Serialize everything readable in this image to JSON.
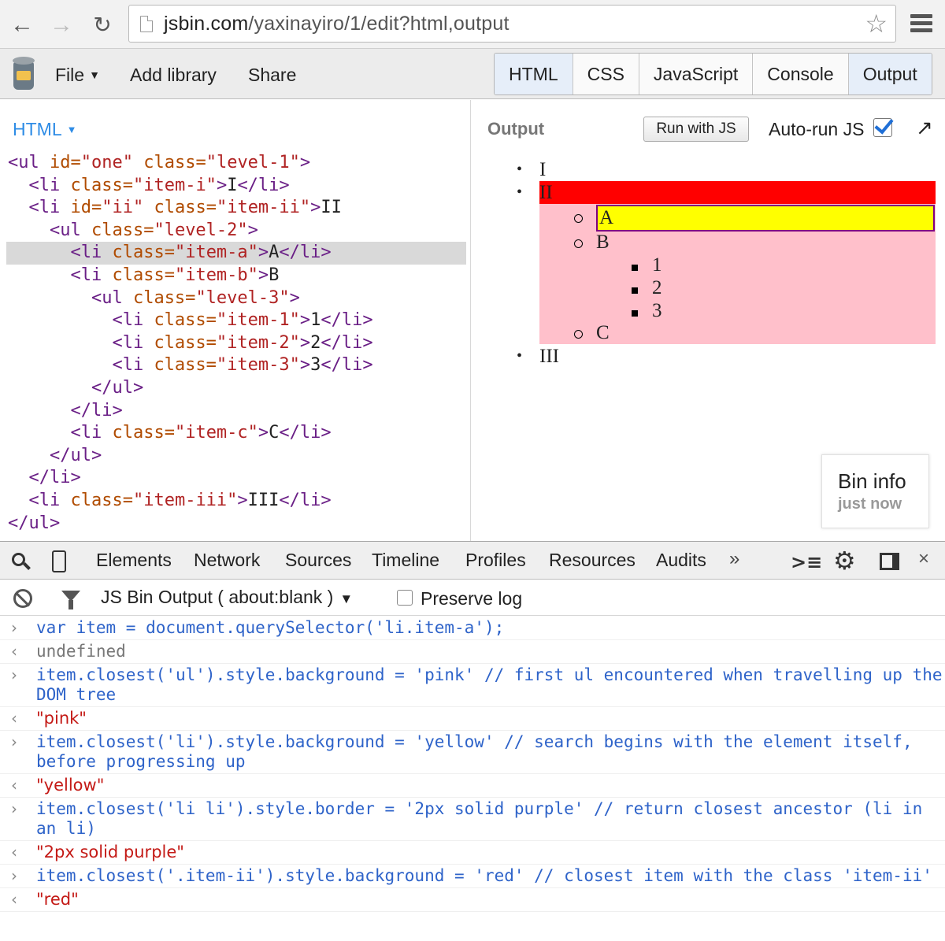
{
  "browser": {
    "back_icon": "back-arrow-icon",
    "forward_icon": "forward-arrow-icon",
    "reload_icon": "reload-icon",
    "url_host": "jsbin.com",
    "url_path": "/yaxinayiro/1/edit?html,output"
  },
  "jsbin": {
    "menu": {
      "file": "File",
      "add_library": "Add library",
      "share": "Share"
    },
    "panel_tabs": [
      "HTML",
      "CSS",
      "JavaScript",
      "Console",
      "Output"
    ]
  },
  "html_pane": {
    "label": "HTML",
    "code_lines": [
      {
        "indent": "",
        "parts": [
          [
            "t",
            "<ul "
          ],
          [
            "a",
            "id="
          ],
          [
            "s",
            "\"one\" "
          ],
          [
            "a",
            "class="
          ],
          [
            "s",
            "\"level-1\""
          ],
          [
            "t",
            ">"
          ]
        ]
      },
      {
        "indent": "  ",
        "parts": [
          [
            "t",
            "<li "
          ],
          [
            "a",
            "class="
          ],
          [
            "s",
            "\"item-i\""
          ],
          [
            "t",
            ">"
          ],
          [
            "x",
            "I"
          ],
          [
            "t",
            "</li>"
          ]
        ]
      },
      {
        "indent": "  ",
        "parts": [
          [
            "t",
            "<li "
          ],
          [
            "a",
            "id="
          ],
          [
            "s",
            "\"ii\" "
          ],
          [
            "a",
            "class="
          ],
          [
            "s",
            "\"item-ii\""
          ],
          [
            "t",
            ">"
          ],
          [
            "x",
            "II"
          ]
        ]
      },
      {
        "indent": "    ",
        "parts": [
          [
            "t",
            "<ul "
          ],
          [
            "a",
            "class="
          ],
          [
            "s",
            "\"level-2\""
          ],
          [
            "t",
            ">"
          ]
        ]
      },
      {
        "indent": "      ",
        "parts": [
          [
            "t",
            "<li "
          ],
          [
            "a",
            "class="
          ],
          [
            "s",
            "\"item-a\""
          ],
          [
            "t",
            ">"
          ],
          [
            "x",
            "A"
          ],
          [
            "t",
            "</li>"
          ]
        ],
        "highlight": true
      },
      {
        "indent": "      ",
        "parts": [
          [
            "t",
            "<li "
          ],
          [
            "a",
            "class="
          ],
          [
            "s",
            "\"item-b\""
          ],
          [
            "t",
            ">"
          ],
          [
            "x",
            "B"
          ]
        ]
      },
      {
        "indent": "        ",
        "parts": [
          [
            "t",
            "<ul "
          ],
          [
            "a",
            "class="
          ],
          [
            "s",
            "\"level-3\""
          ],
          [
            "t",
            ">"
          ]
        ]
      },
      {
        "indent": "          ",
        "parts": [
          [
            "t",
            "<li "
          ],
          [
            "a",
            "class="
          ],
          [
            "s",
            "\"item-1\""
          ],
          [
            "t",
            ">"
          ],
          [
            "x",
            "1"
          ],
          [
            "t",
            "</li>"
          ]
        ]
      },
      {
        "indent": "          ",
        "parts": [
          [
            "t",
            "<li "
          ],
          [
            "a",
            "class="
          ],
          [
            "s",
            "\"item-2\""
          ],
          [
            "t",
            ">"
          ],
          [
            "x",
            "2"
          ],
          [
            "t",
            "</li>"
          ]
        ]
      },
      {
        "indent": "          ",
        "parts": [
          [
            "t",
            "<li "
          ],
          [
            "a",
            "class="
          ],
          [
            "s",
            "\"item-3\""
          ],
          [
            "t",
            ">"
          ],
          [
            "x",
            "3"
          ],
          [
            "t",
            "</li>"
          ]
        ]
      },
      {
        "indent": "        ",
        "parts": [
          [
            "t",
            "</ul>"
          ]
        ]
      },
      {
        "indent": "      ",
        "parts": [
          [
            "t",
            "</li>"
          ]
        ]
      },
      {
        "indent": "      ",
        "parts": [
          [
            "t",
            "<li "
          ],
          [
            "a",
            "class="
          ],
          [
            "s",
            "\"item-c\""
          ],
          [
            "t",
            ">"
          ],
          [
            "x",
            "C"
          ],
          [
            "t",
            "</li>"
          ]
        ]
      },
      {
        "indent": "    ",
        "parts": [
          [
            "t",
            "</ul>"
          ]
        ]
      },
      {
        "indent": "  ",
        "parts": [
          [
            "t",
            "</li>"
          ]
        ]
      },
      {
        "indent": "  ",
        "parts": [
          [
            "t",
            "<li "
          ],
          [
            "a",
            "class="
          ],
          [
            "s",
            "\"item-iii\""
          ],
          [
            "t",
            ">"
          ],
          [
            "x",
            "III"
          ],
          [
            "t",
            "</li>"
          ]
        ]
      },
      {
        "indent": "",
        "parts": [
          [
            "t",
            "</ul>"
          ]
        ]
      }
    ]
  },
  "output_pane": {
    "label": "Output",
    "run_button": "Run with JS",
    "autorun_label": "Auto-run JS",
    "autorun_checked": true,
    "list": {
      "item_i": "I",
      "item_ii": "II",
      "item_a": "A",
      "item_b": "B",
      "item_1": "1",
      "item_2": "2",
      "item_3": "3",
      "item_c": "C",
      "item_iii": "III"
    },
    "colors": {
      "ul_level2_background": "#ffc0cb",
      "item_ii_background": "#ff0000",
      "item_a_background": "#ffff00",
      "item_a_border": "#800080"
    },
    "bin_info": {
      "title": "Bin info",
      "time": "just now"
    }
  },
  "devtools": {
    "tabs": [
      "Elements",
      "Network",
      "Sources",
      "Timeline",
      "Profiles",
      "Resources",
      "Audits"
    ],
    "more": "»",
    "context": "JS Bin Output ( about:blank )",
    "preserve_log": "Preserve log",
    "entries": [
      {
        "type": "cmd",
        "text": "var item = document.querySelector('li.item-a');"
      },
      {
        "type": "undef",
        "text": "undefined"
      },
      {
        "type": "cmd",
        "text": "item.closest('ul').style.background = 'pink' // first ul encountered when travelling up the DOM tree"
      },
      {
        "type": "res",
        "text": "\"pink\""
      },
      {
        "type": "cmd",
        "text": "item.closest('li').style.background = 'yellow' // search begins with the element itself, before progressing up"
      },
      {
        "type": "res",
        "text": "\"yellow\""
      },
      {
        "type": "cmd",
        "text": "item.closest('li li').style.border = '2px solid purple' // return closest ancestor (li in an li)"
      },
      {
        "type": "res",
        "text": "\"2px solid purple\""
      },
      {
        "type": "cmd",
        "text": "item.closest('.item-ii').style.background = 'red' // closest item with the class 'item-ii'"
      },
      {
        "type": "res",
        "text": "\"red\""
      }
    ]
  }
}
